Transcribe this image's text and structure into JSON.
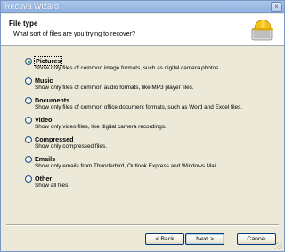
{
  "window": {
    "title": "Recuva Wizard",
    "close_glyph": "×"
  },
  "header": {
    "title": "File type",
    "subtitle": "What sort of files are you trying to recover?",
    "logo_icon": "recuva-hardhat-drive-icon"
  },
  "options": [
    {
      "label": "Pictures",
      "description": "Show only files of common image formats, such as digital camera photos.",
      "checked": true
    },
    {
      "label": "Music",
      "description": "Show only files of common audio formats, like MP3 player files.",
      "checked": false
    },
    {
      "label": "Documents",
      "description": "Show only files of common office document formats, such as Word and Excel files.",
      "checked": false
    },
    {
      "label": "Video",
      "description": "Show only video files, like digital camera recordings.",
      "checked": false
    },
    {
      "label": "Compressed",
      "description": "Show only compressed files.",
      "checked": false
    },
    {
      "label": "Emails",
      "description": "Show only emails from Thunderbird, Outlook Express and Windows Mail.",
      "checked": false
    },
    {
      "label": "Other",
      "description": "Show all files.",
      "checked": false
    }
  ],
  "buttons": {
    "back": "< Back",
    "next": "Next >",
    "cancel": "Cancel"
  },
  "colors": {
    "window_bg": "#ece9d8",
    "titlebar": "#9dbde6",
    "radio_selected": "#21a121"
  }
}
